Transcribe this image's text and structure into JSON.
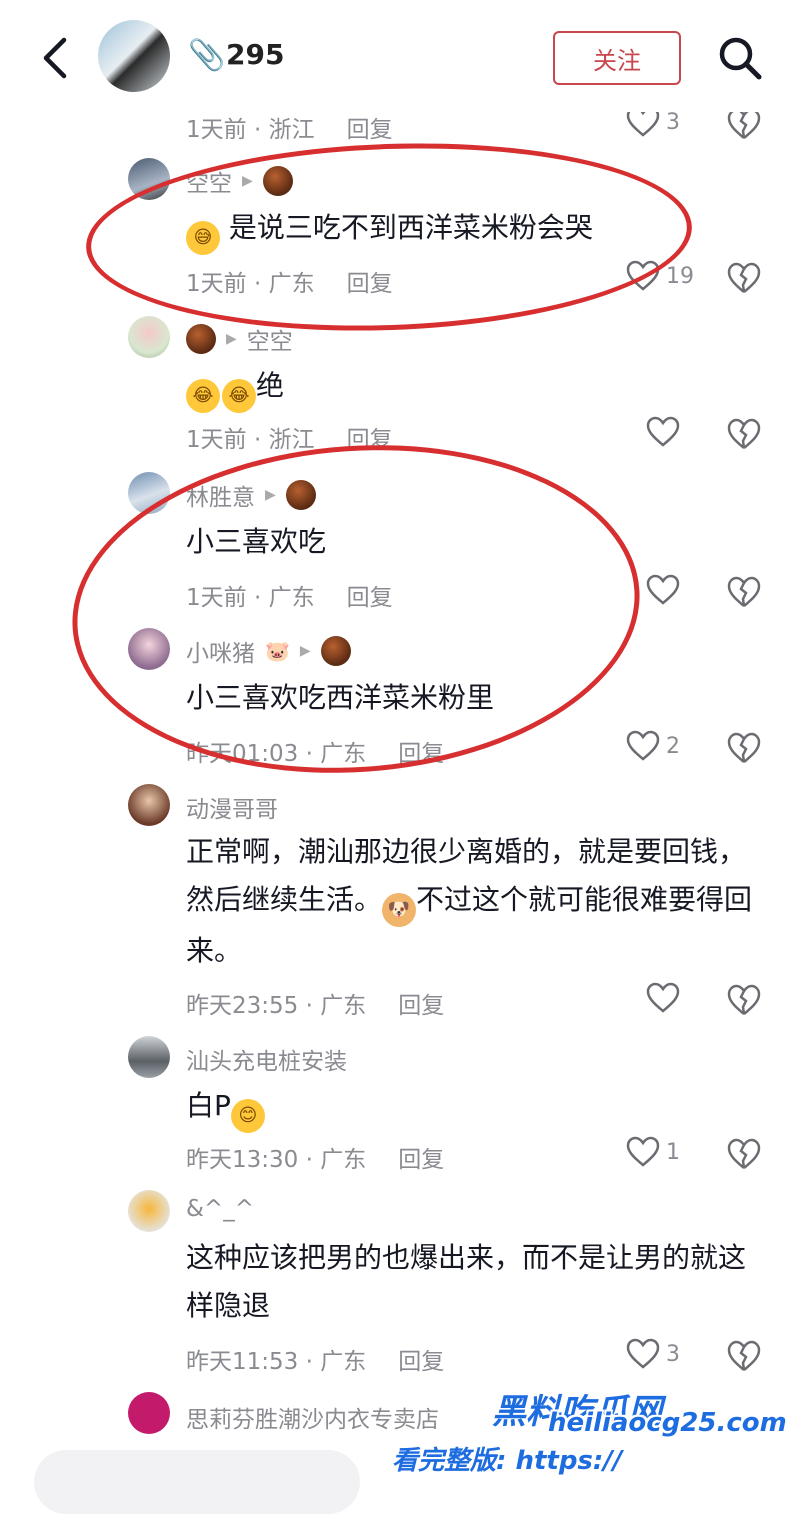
{
  "header": {
    "count": "295",
    "follow_label": "关注"
  },
  "comments": [
    {
      "time": "1天前 · 浙江",
      "reply": "回复",
      "likes": "3"
    },
    {
      "author": "空空",
      "text": "是说三吃不到西洋菜米粉会哭",
      "time": "1天前 · 广东",
      "reply": "回复",
      "likes": "19"
    },
    {
      "reply_to": "空空",
      "text": "绝",
      "time": "1天前 · 浙江",
      "reply": "回复",
      "likes": ""
    },
    {
      "author": "林胜意",
      "text": "小三喜欢吃",
      "time": "1天前 · 广东",
      "reply": "回复",
      "likes": ""
    },
    {
      "author": "小咪猪",
      "text": "小三喜欢吃西洋菜米粉里",
      "time": "昨天01:03 · 广东",
      "reply": "回复",
      "likes": "2"
    },
    {
      "author": "动漫哥哥",
      "text_a": "正常啊，潮汕那边很少离婚的，就是要回钱，然后继续生活。",
      "text_b": "不过这个就可能很难要得回来。",
      "time": "昨天23:55 · 广东",
      "reply": "回复",
      "likes": ""
    },
    {
      "author": "汕头充电桩安装",
      "text": "白P",
      "time": "昨天13:30 · 广东",
      "reply": "回复",
      "likes": "1"
    },
    {
      "author": "&^_^",
      "text": "这种应该把男的也爆出来，而不是让男的就这样隐退",
      "time": "昨天11:53 · 广东",
      "reply": "回复",
      "likes": "3"
    },
    {
      "author": "思莉芬胜潮沙内衣专卖店"
    }
  ],
  "watermark": {
    "title": "黑料吃瓜网",
    "url_prefix": "看完整版: https://",
    "url_domain": "heiliaocg25.com"
  }
}
